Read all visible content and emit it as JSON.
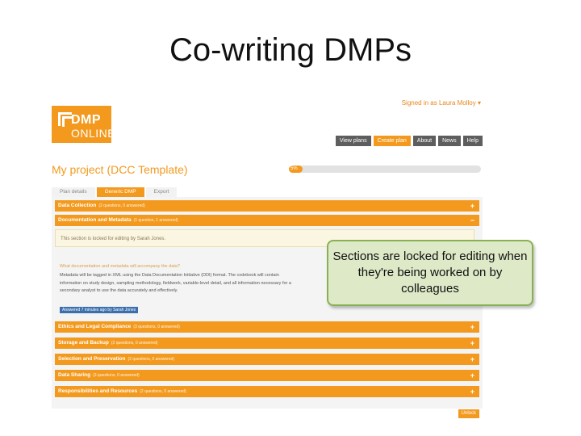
{
  "slide": {
    "title": "Co-writing DMPs",
    "callout": "Sections are locked for editing when they're being worked on by colleagues"
  },
  "app": {
    "signed_in": "Signed in as Laura Molloy ▾",
    "logo": {
      "line1": "DMP",
      "line2": "ONLINE"
    },
    "nav": [
      "View plans",
      "Create plan",
      "About",
      "News",
      "Help"
    ],
    "project_title": "My project (DCC Template)",
    "progress": {
      "label": "5%",
      "fraction": 0.05
    },
    "tabs": [
      "Plan details",
      "Generic DMP",
      "Export"
    ],
    "active_tab": "Generic DMP",
    "sections": [
      {
        "title": "Data Collection",
        "status": "(2 questions, 0 answered)",
        "toggle": "+"
      },
      {
        "title": "Documentation and Metadata",
        "status": "(1 question, 1 answered)",
        "toggle": "−"
      },
      {
        "title": "Ethics and Legal Compliance",
        "status": "(3 questions, 0 answered)",
        "toggle": "+"
      },
      {
        "title": "Storage and Backup",
        "status": "(2 questions, 0 answered)",
        "toggle": "+"
      },
      {
        "title": "Selection and Preservation",
        "status": "(2 questions, 0 answered)",
        "toggle": "+"
      },
      {
        "title": "Data Sharing",
        "status": "(3 questions, 0 answered)",
        "toggle": "+"
      },
      {
        "title": "Responsibilities and Resources",
        "status": "(2 questions, 0 answered)",
        "toggle": "+"
      }
    ],
    "lock_notice": "This section is locked for editing by Sarah Jones.",
    "question": "What documentation and metadata will accompany the data?",
    "answer": "Metadata will be tagged in XML using the Data Documentation Initiative (DDI) format. The codebook will contain information on study design, sampling methodology, fieldwork, variable-level detail, and all information necessary for a secondary analyst to use the data accurately and effectively.",
    "saved_note": "Answered 7 minutes ago by Sarah Jones",
    "unlock_button": "Unlock"
  },
  "colors": {
    "accent": "#f39a1e",
    "nav_dark": "#5e5e5e",
    "callout_bg": "#dde9c7",
    "callout_border": "#8ab055",
    "saved_blue": "#3c70ad"
  }
}
